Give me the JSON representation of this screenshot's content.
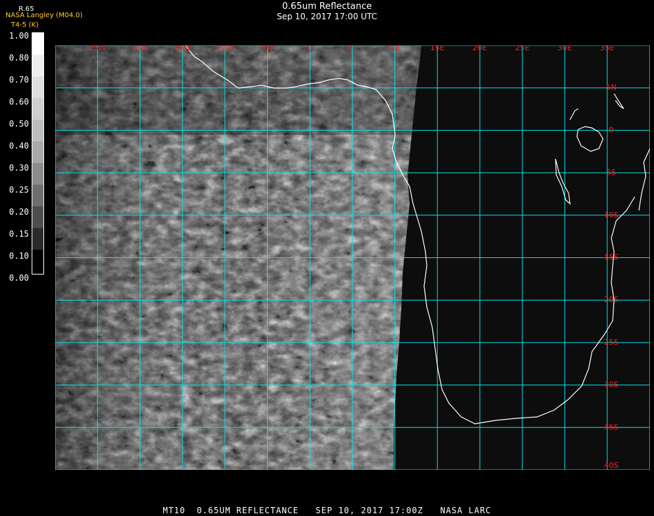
{
  "header": {
    "title": "0.65um Reflectance",
    "datetime": "Sep 10, 2017 17:00 UTC",
    "provider": "NASA Langley (M04.0)",
    "algorithm": "T4-5 (K)",
    "scale_label": "R.65"
  },
  "colorbar": {
    "ticks": [
      "1.00",
      "0.80",
      "0.70",
      "0.60",
      "0.50",
      "0.40",
      "0.30",
      "0.25",
      "0.20",
      "0.15",
      "0.10",
      "0.00"
    ]
  },
  "map": {
    "lon_labels": [
      "25W",
      "20W",
      "15W",
      "10W",
      "5W",
      "0",
      "5E",
      "10E",
      "15E",
      "20E",
      "25E",
      "30E",
      "35E"
    ],
    "lat_labels": [
      "5N",
      "0",
      "5S",
      "10S",
      "15S",
      "20S",
      "25S",
      "30S",
      "35S",
      "40S"
    ],
    "colors": {
      "grid": "#00e5ee",
      "labels": "#ff2020",
      "coastline": "#ffffff",
      "background": "#0d0d0d"
    }
  },
  "footer": {
    "text": "MT10  0.65UM REFLECTANCE   SEP 10, 2017 17:00Z   NASA LARC"
  }
}
